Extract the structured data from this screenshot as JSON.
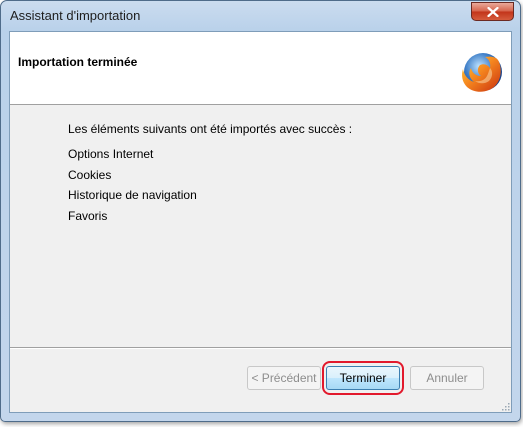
{
  "window": {
    "title": "Assistant d'importation"
  },
  "header": {
    "title": "Importation terminée",
    "logo_icon": "firefox-logo-icon"
  },
  "content": {
    "intro": "Les éléments suivants ont été importés avec succès :",
    "items": [
      "Options Internet",
      "Cookies",
      "Historique de navigation",
      "Favoris"
    ]
  },
  "buttons": {
    "previous_label": "< Précédent",
    "finish_label": "Terminer",
    "cancel_label": "Annuler"
  },
  "colors": {
    "highlight": "#e2192c",
    "close_button": "#c2341a"
  }
}
